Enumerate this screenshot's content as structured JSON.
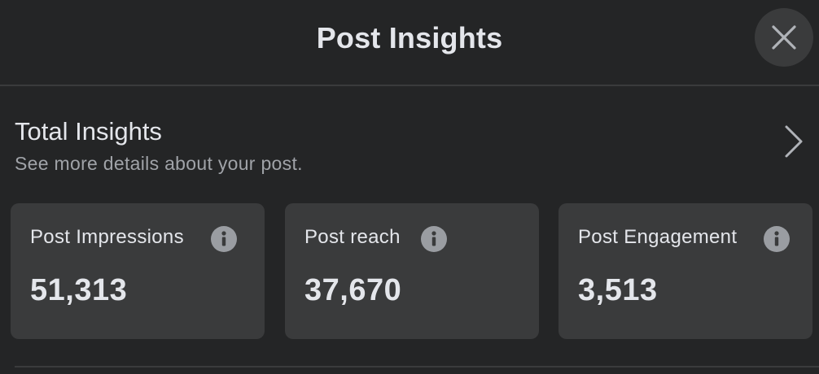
{
  "header": {
    "title": "Post Insights",
    "close_icon": "close-icon"
  },
  "total_insights": {
    "title": "Total Insights",
    "subtitle": "See more details about your post.",
    "chevron_icon": "chevron-right-icon"
  },
  "metrics": [
    {
      "label": "Post Impressions",
      "value": "51,313",
      "icon": "info-icon"
    },
    {
      "label": "Post reach",
      "value": "37,670",
      "icon": "info-icon"
    },
    {
      "label": "Post Engagement",
      "value": "3,513",
      "icon": "info-icon"
    }
  ],
  "colors": {
    "background": "#242526",
    "card": "#3a3b3c",
    "text_primary": "#e4e6eb",
    "text_secondary": "#a0a3a8",
    "info_icon": "#9a9da2"
  }
}
